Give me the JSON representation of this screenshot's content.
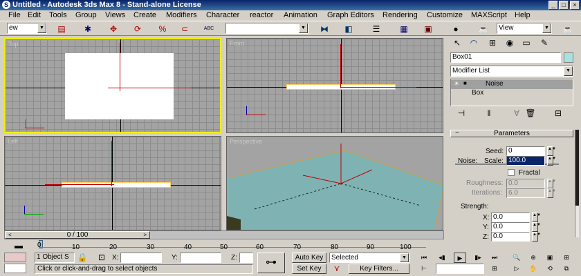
{
  "window": {
    "title": "Untitled - Autodesk 3ds Max 8 - Stand-alone License",
    "minimize": "_",
    "maximize": "□",
    "close": "×"
  },
  "menu": [
    "File",
    "Edit",
    "Tools",
    "Group",
    "Views",
    "Create",
    "Modifiers",
    "Character",
    "reactor",
    "Animation",
    "Graph Editors",
    "Rendering",
    "Customize",
    "MAXScript",
    "Help"
  ],
  "toolbar": {
    "selection_filter": "ew",
    "named_selection": "",
    "reference_coord": "View",
    "abc": "ABC"
  },
  "command_panel": {
    "object_name": "Box01",
    "object_color": "#a8e0e0",
    "modifier_list": "Modifier List",
    "stack": [
      "Noise",
      "Box"
    ],
    "rollout_title": "Parameters",
    "noise_group": "Noise:",
    "seed_label": "Seed:",
    "seed_value": "0",
    "scale_label": "Scale:",
    "scale_value": "100.0",
    "fractal_label": "Fractal",
    "roughness_label": "Roughness:",
    "roughness_value": "0.0",
    "iterations_label": "Iterations:",
    "iterations_value": "6.0",
    "strength_group": "Strength:",
    "x_label": "X:",
    "x_value": "0.0",
    "y_label": "Y:",
    "y_value": "0.0",
    "z_label": "Z:",
    "z_value": "0.0"
  },
  "viewports": [
    "Top",
    "Front",
    "Left",
    "Perspective"
  ],
  "timeline": {
    "frame": "0 / 100",
    "ticks": [
      "0",
      "10",
      "20",
      "30",
      "40",
      "50",
      "60",
      "70",
      "80",
      "90",
      "100"
    ]
  },
  "status": {
    "selection": "1 Object S",
    "x_label": "X:",
    "y_label": "Y:",
    "z_label": "Z:",
    "prompt": "Click or click-and-drag to select objects",
    "auto_key": "Auto Key",
    "set_key": "Set Key",
    "key_mode": "Selected",
    "key_filters": "Key Filters..."
  }
}
